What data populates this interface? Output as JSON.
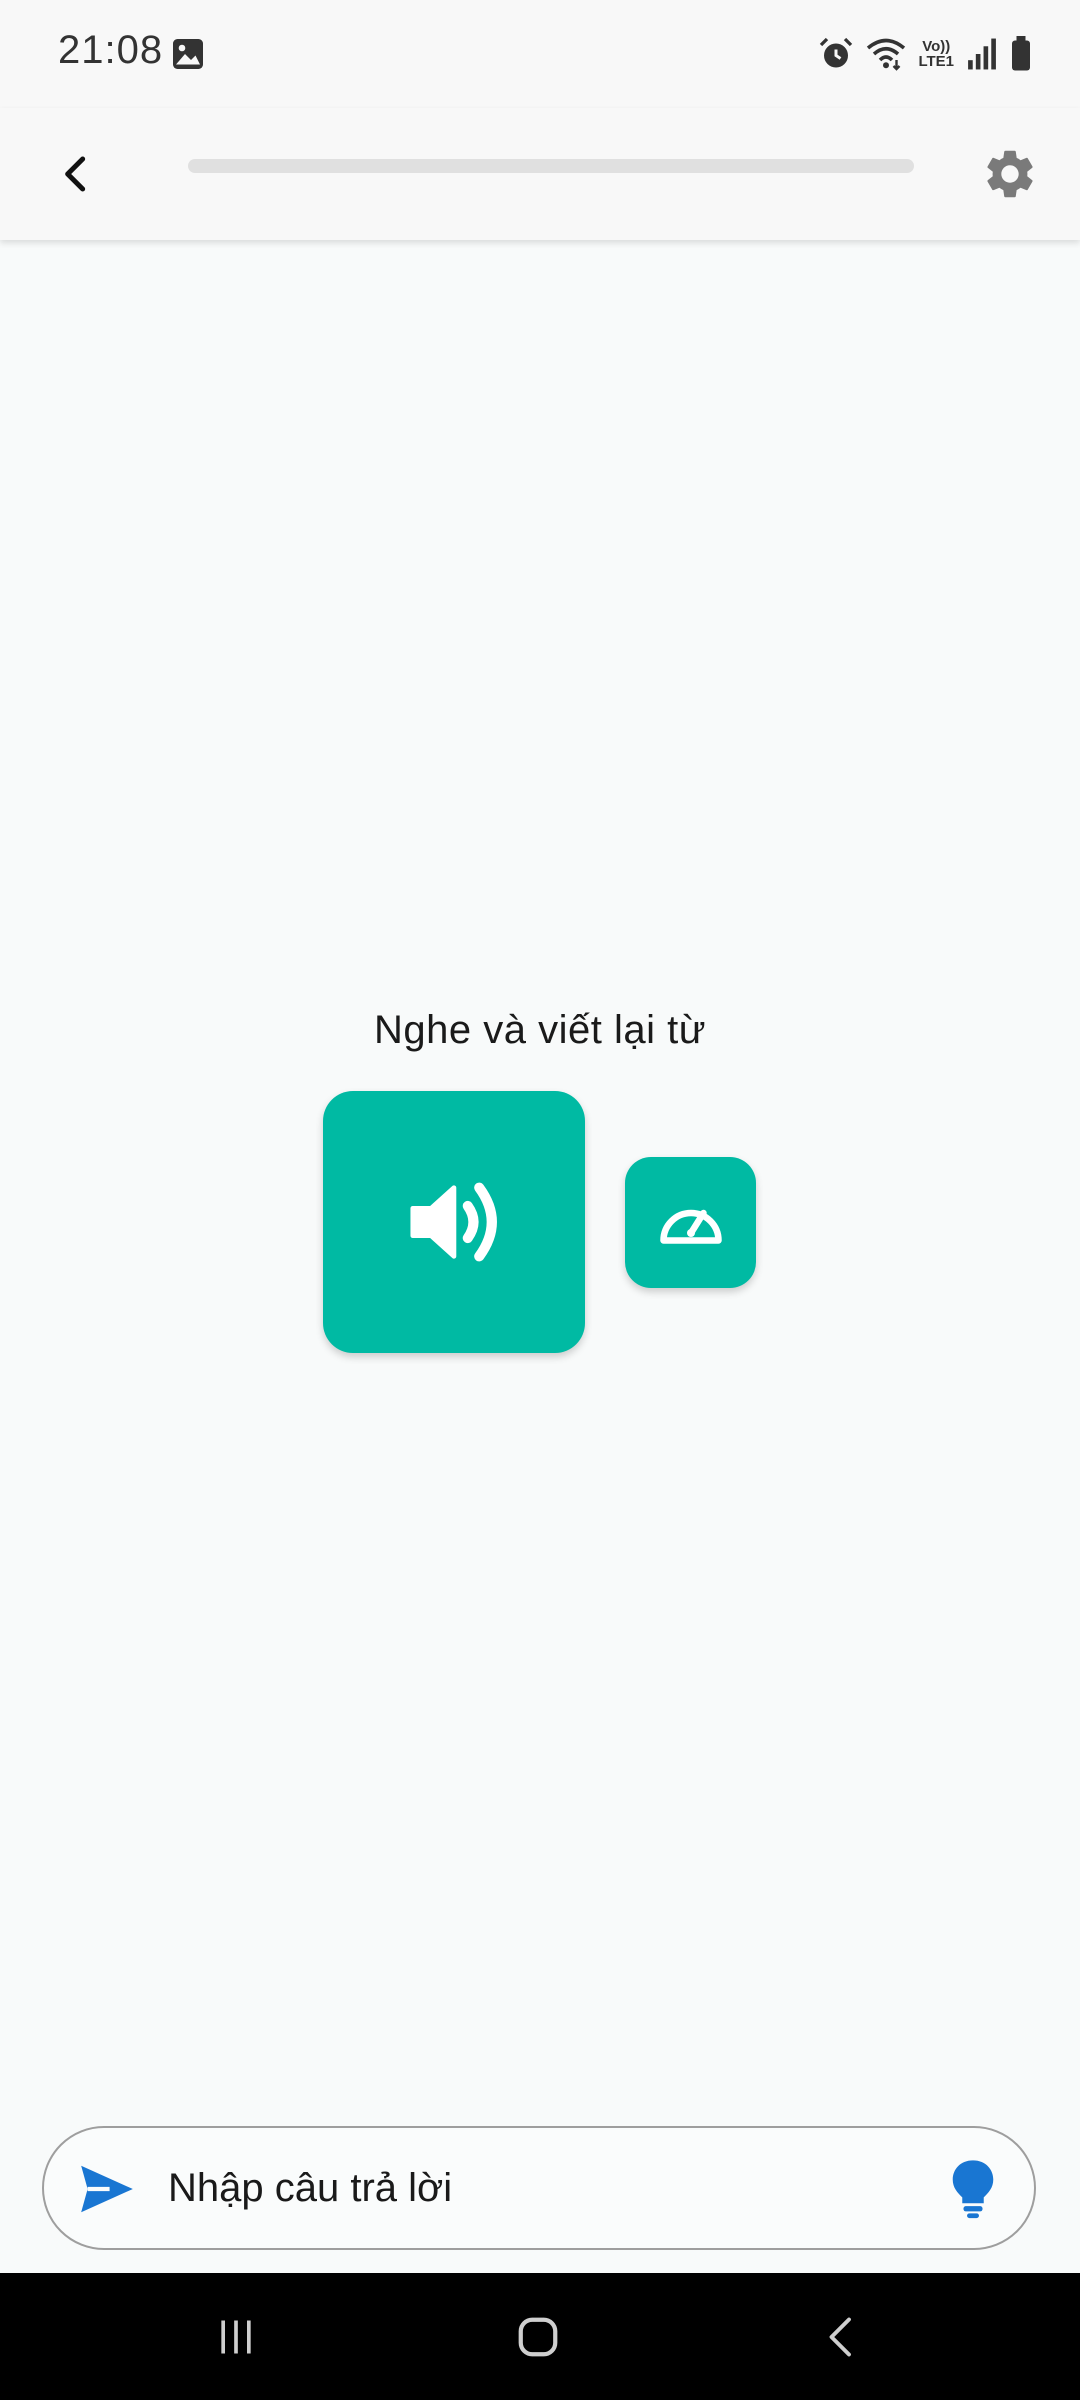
{
  "status_bar": {
    "time": "21:08",
    "icons": [
      "gallery-icon",
      "alarm-icon",
      "wifi-icon",
      "volte-icon",
      "signal-icon",
      "battery-icon"
    ],
    "volte_line1": "Vo))",
    "volte_line2": "LTE1"
  },
  "app_bar": {
    "back_icon": "chevron-left-icon",
    "progress_fraction": 0.0,
    "settings_icon": "gear-icon"
  },
  "main": {
    "prompt": "Nghe và viết lại từ",
    "play_icon": "speaker-icon",
    "speed_icon": "speedometer-icon"
  },
  "answer": {
    "placeholder": "Nhập câu trả lời",
    "value": "",
    "send_icon": "send-icon",
    "hint_icon": "lightbulb-icon"
  },
  "nav_bar": {
    "icons": [
      "recents-icon",
      "home-icon",
      "back-icon"
    ]
  },
  "colors": {
    "accent": "#00baa3",
    "send_blue": "#1976d2",
    "background": "#f8fafa"
  }
}
